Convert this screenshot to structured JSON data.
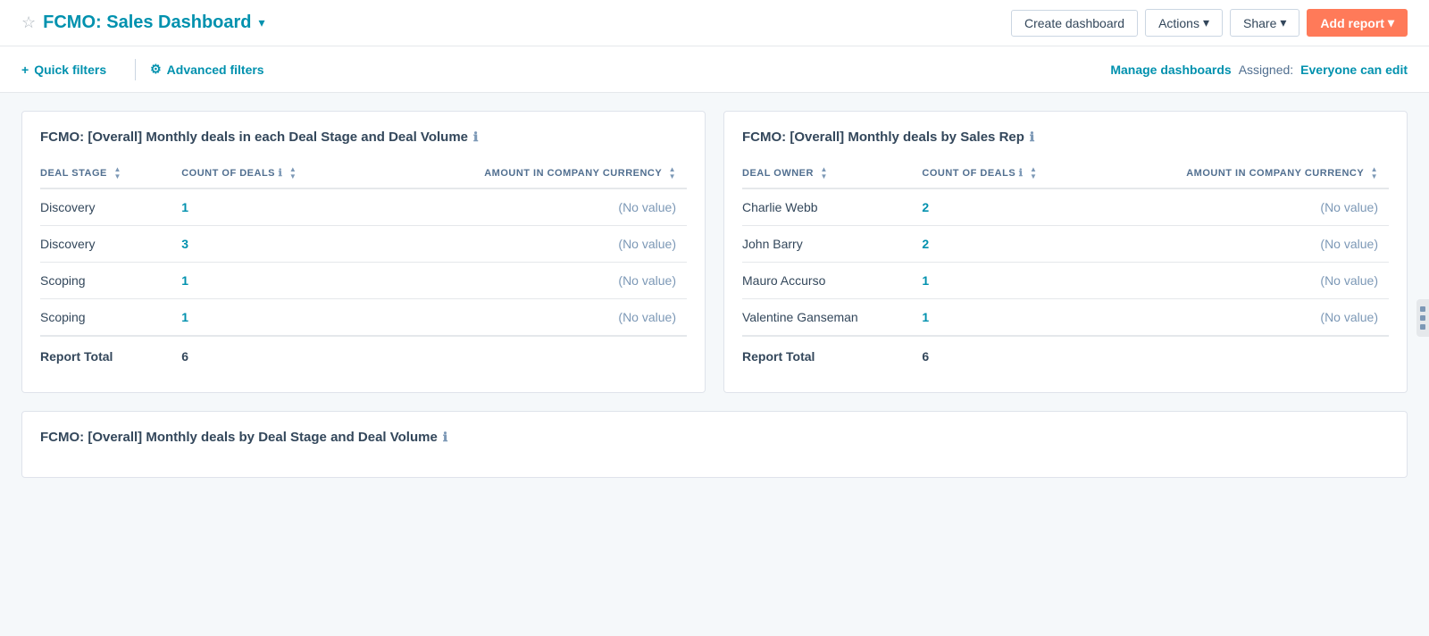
{
  "header": {
    "star_label": "☆",
    "title": "FCMO: Sales Dashboard",
    "chevron": "▾",
    "create_dashboard": "Create dashboard",
    "actions": "Actions",
    "share": "Share",
    "add_report": "Add report"
  },
  "filters": {
    "quick_filters": "Quick filters",
    "advanced_filters": "Advanced filters",
    "manage_dashboards": "Manage dashboards",
    "assigned_label": "Assigned:",
    "assigned_value": "Everyone can edit"
  },
  "report1": {
    "title": "FCMO: [Overall] Monthly deals in each Deal Stage and Deal Volume",
    "columns": [
      {
        "label": "DEAL STAGE",
        "sortable": true
      },
      {
        "label": "COUNT OF DEALS",
        "sortable": true,
        "has_info": true
      },
      {
        "label": "AMOUNT IN COMPANY CURRENCY",
        "sortable": true
      }
    ],
    "rows": [
      {
        "deal_stage": "Discovery",
        "count": "1",
        "amount": "(No value)"
      },
      {
        "deal_stage": "Discovery",
        "count": "3",
        "amount": "(No value)"
      },
      {
        "deal_stage": "Scoping",
        "count": "1",
        "amount": "(No value)"
      },
      {
        "deal_stage": "Scoping",
        "count": "1",
        "amount": "(No value)"
      }
    ],
    "total_label": "Report Total",
    "total_count": "6",
    "total_amount": ""
  },
  "report2": {
    "title": "FCMO: [Overall] Monthly deals by Sales Rep",
    "columns": [
      {
        "label": "DEAL OWNER",
        "sortable": true
      },
      {
        "label": "COUNT OF DEALS",
        "sortable": true,
        "has_info": true
      },
      {
        "label": "AMOUNT IN COMPANY CURRENCY",
        "sortable": true
      }
    ],
    "rows": [
      {
        "deal_owner": "Charlie Webb",
        "count": "2",
        "amount": "(No value)"
      },
      {
        "deal_owner": "John Barry",
        "count": "2",
        "amount": "(No value)"
      },
      {
        "deal_owner": "Mauro Accurso",
        "count": "1",
        "amount": "(No value)"
      },
      {
        "deal_owner": "Valentine Ganseman",
        "count": "1",
        "amount": "(No value)"
      }
    ],
    "total_label": "Report Total",
    "total_count": "6",
    "total_amount": ""
  },
  "report3": {
    "title": "FCMO: [Overall] Monthly deals by Deal Stage and Deal Volume"
  }
}
